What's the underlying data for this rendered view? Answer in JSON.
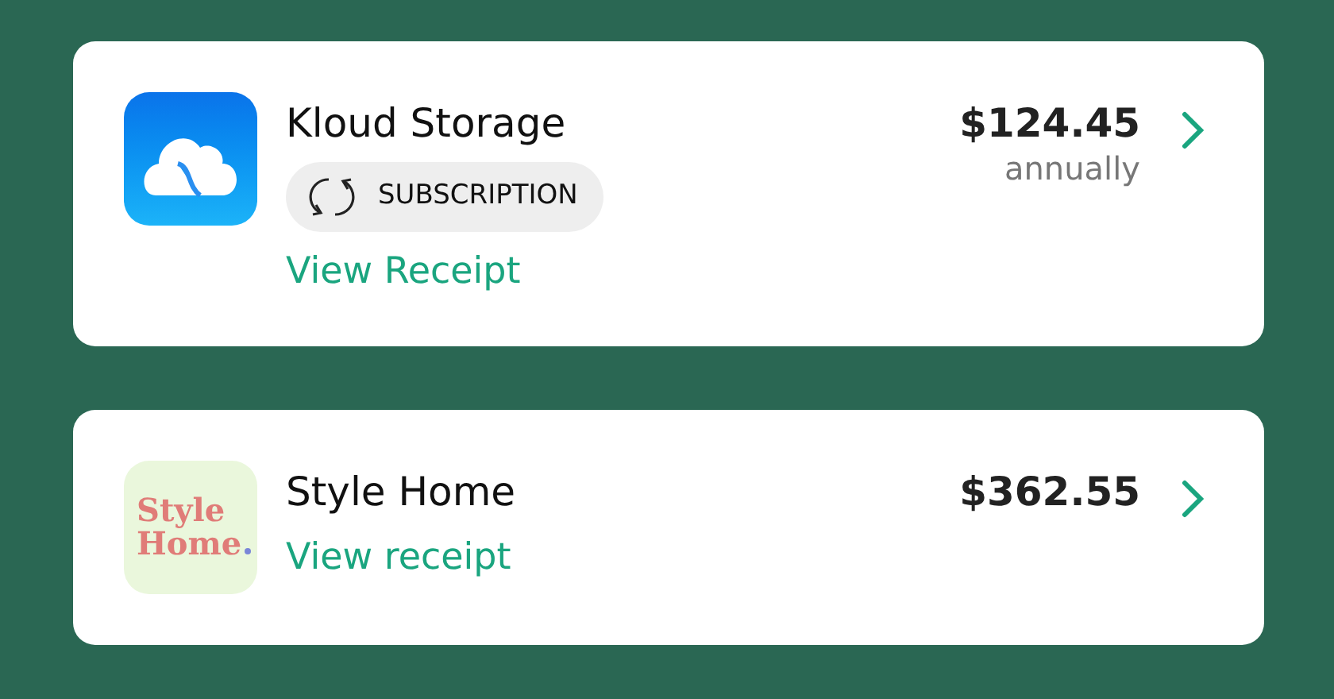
{
  "purchases": [
    {
      "name": "Kloud Storage",
      "logo": {
        "kind": "cloud"
      },
      "badge": "SUBSCRIPTION",
      "link": "View Receipt",
      "price": "$124.45",
      "period": "annually"
    },
    {
      "name": "Style Home",
      "logo": {
        "kind": "wordmark",
        "lines": [
          "Style",
          "Home"
        ]
      },
      "link": "View receipt",
      "price": "$362.55"
    }
  ]
}
